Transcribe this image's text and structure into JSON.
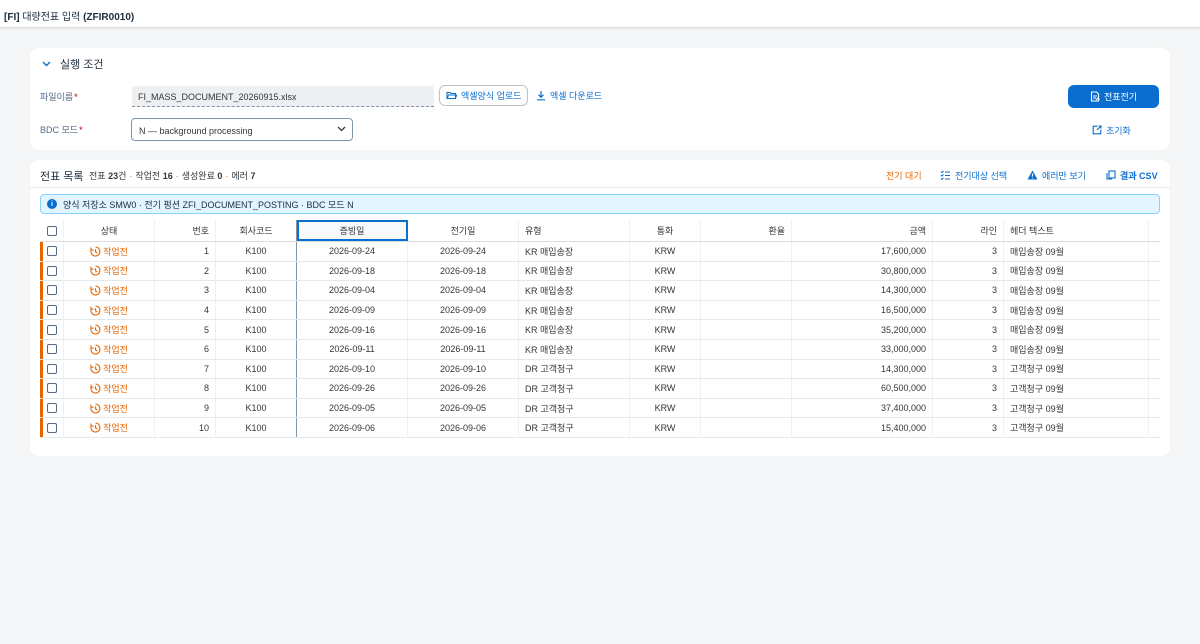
{
  "app": {
    "prefix": "[FI]",
    "title": "대량전표 입력",
    "code": "(ZFIR0010)"
  },
  "conditions": {
    "section_title": "실행 조건",
    "file_label": "파일이름",
    "file_value": "FI_MASS_DOCUMENT_20260915.xlsx",
    "upload_label": "엑셀양식 업로드",
    "download_label": "엑셀 다운로드",
    "post_label": "전표전기",
    "bdc_label": "BDC 모드",
    "bdc_value": "N — background processing",
    "reset_label": "초기화"
  },
  "list": {
    "title": "전표 목록",
    "stat_prefix": "전표",
    "total": "23",
    "total_unit": "건",
    "pending_label": "작업전",
    "pending": "16",
    "created_label": "생성완료",
    "created": "0",
    "error_label": "에러",
    "error": "7",
    "action_wait": "전기 대기",
    "action_select": "전기대상 선택",
    "action_errors": "에러만 보기",
    "action_csv": "결과 CSV",
    "info": "양식 저장소 SMW0 · 전기 펑션 ZFI_DOCUMENT_POSTING · BDC 모드 N"
  },
  "columns": [
    "상태",
    "번호",
    "회사코드",
    "증빙일",
    "전기일",
    "유형",
    "통화",
    "환율",
    "금액",
    "라인",
    "헤더 텍스트"
  ],
  "rows": [
    {
      "status": "작업전",
      "no": "1",
      "company": "K100",
      "doc_date": "2026-09-24",
      "post_date": "2026-09-24",
      "type": "KR 매입송장",
      "currency": "KRW",
      "rate": "",
      "amount": "17,600,000",
      "lines": "3",
      "header": "매입송장 09월"
    },
    {
      "status": "작업전",
      "no": "2",
      "company": "K100",
      "doc_date": "2026-09-18",
      "post_date": "2026-09-18",
      "type": "KR 매입송장",
      "currency": "KRW",
      "rate": "",
      "amount": "30,800,000",
      "lines": "3",
      "header": "매입송장 09월"
    },
    {
      "status": "작업전",
      "no": "3",
      "company": "K100",
      "doc_date": "2026-09-04",
      "post_date": "2026-09-04",
      "type": "KR 매입송장",
      "currency": "KRW",
      "rate": "",
      "amount": "14,300,000",
      "lines": "3",
      "header": "매입송장 09월"
    },
    {
      "status": "작업전",
      "no": "4",
      "company": "K100",
      "doc_date": "2026-09-09",
      "post_date": "2026-09-09",
      "type": "KR 매입송장",
      "currency": "KRW",
      "rate": "",
      "amount": "16,500,000",
      "lines": "3",
      "header": "매입송장 09월"
    },
    {
      "status": "작업전",
      "no": "5",
      "company": "K100",
      "doc_date": "2026-09-16",
      "post_date": "2026-09-16",
      "type": "KR 매입송장",
      "currency": "KRW",
      "rate": "",
      "amount": "35,200,000",
      "lines": "3",
      "header": "매입송장 09월"
    },
    {
      "status": "작업전",
      "no": "6",
      "company": "K100",
      "doc_date": "2026-09-11",
      "post_date": "2026-09-11",
      "type": "KR 매입송장",
      "currency": "KRW",
      "rate": "",
      "amount": "33,000,000",
      "lines": "3",
      "header": "매입송장 09월"
    },
    {
      "status": "작업전",
      "no": "7",
      "company": "K100",
      "doc_date": "2026-09-10",
      "post_date": "2026-09-10",
      "type": "DR 고객청구",
      "currency": "KRW",
      "rate": "",
      "amount": "14,300,000",
      "lines": "3",
      "header": "고객청구 09월"
    },
    {
      "status": "작업전",
      "no": "8",
      "company": "K100",
      "doc_date": "2026-09-26",
      "post_date": "2026-09-26",
      "type": "DR 고객청구",
      "currency": "KRW",
      "rate": "",
      "amount": "60,500,000",
      "lines": "3",
      "header": "고객청구 09월"
    },
    {
      "status": "작업전",
      "no": "9",
      "company": "K100",
      "doc_date": "2026-09-05",
      "post_date": "2026-09-05",
      "type": "DR 고객청구",
      "currency": "KRW",
      "rate": "",
      "amount": "37,400,000",
      "lines": "3",
      "header": "고객청구 09월"
    },
    {
      "status": "작업전",
      "no": "10",
      "company": "K100",
      "doc_date": "2026-09-06",
      "post_date": "2026-09-06",
      "type": "DR 고객청구",
      "currency": "KRW",
      "rate": "",
      "amount": "15,400,000",
      "lines": "3",
      "header": "고객청구 09월"
    }
  ],
  "colors": {
    "accent": "#0a6ed1",
    "warning": "#e76500",
    "error": "#bb0000",
    "info_bg": "#e1f4ff"
  }
}
